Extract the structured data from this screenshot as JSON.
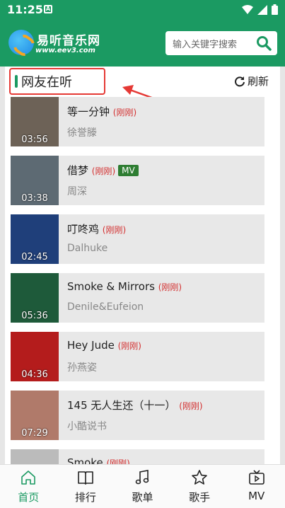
{
  "status": {
    "time": "11:25",
    "notif": "A"
  },
  "header": {
    "site_name": "易听音乐网",
    "site_url": "www.eev3.com",
    "search_placeholder": "输入关键字搜索"
  },
  "section": {
    "title": "网友在听",
    "refresh_label": "刷新"
  },
  "songs": [
    {
      "title": "等一分钟",
      "tag": "(刚刚)",
      "artist": "徐誉滕",
      "duration": "03:56",
      "mv": "",
      "cover": "#6d6257"
    },
    {
      "title": "借梦",
      "tag": "(刚刚)",
      "artist": "周深",
      "duration": "03:38",
      "mv": "MV",
      "cover": "#5d6a73"
    },
    {
      "title": "叮咚鸡",
      "tag": "(刚刚)",
      "artist": "Dalhuke",
      "duration": "02:45",
      "mv": "",
      "cover": "#1f3f7a"
    },
    {
      "title": "Smoke & Mirrors",
      "tag": "(刚刚)",
      "artist": "Denile&Eufeion",
      "duration": "05:36",
      "mv": "",
      "cover": "#1e5a3a"
    },
    {
      "title": "Hey Jude",
      "tag": "(刚刚)",
      "artist": "孙燕姿",
      "duration": "04:36",
      "mv": "",
      "cover": "#b41c1c"
    },
    {
      "title": "145 无人生还（十一）",
      "tag": "(刚刚)",
      "artist": "小酷说书",
      "duration": "07:29",
      "mv": "",
      "cover": "#b07a6a"
    },
    {
      "title": "Smoke",
      "tag": "(刚刚)",
      "artist": "",
      "duration": "",
      "mv": "",
      "cover": "#bbbbbb"
    }
  ],
  "tabs": [
    {
      "label": "首页",
      "icon": "home-icon",
      "active": true
    },
    {
      "label": "排行",
      "icon": "book-icon",
      "active": false
    },
    {
      "label": "歌单",
      "icon": "music-note-icon",
      "active": false
    },
    {
      "label": "歌手",
      "icon": "star-icon",
      "active": false
    },
    {
      "label": "MV",
      "icon": "tv-icon",
      "active": false
    }
  ],
  "colors": {
    "brand": "#1b9a62",
    "tag": "#d32f2f",
    "highlight": "#e53935"
  }
}
